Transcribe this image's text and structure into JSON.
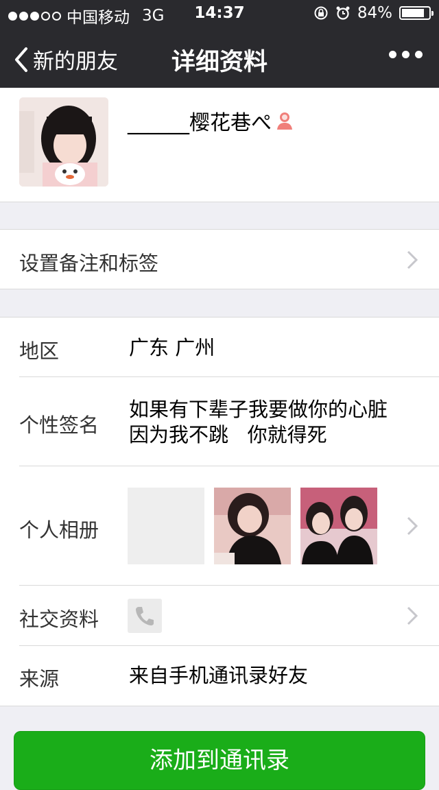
{
  "status_bar": {
    "carrier": "中国移动",
    "network": "3G",
    "time": "14:37",
    "battery": "84%",
    "battery_level": 0.84
  },
  "nav": {
    "back_label": "新的朋友",
    "title": "详细资料"
  },
  "profile": {
    "nickname": "______樱花巷ぺ"
  },
  "remark": {
    "label": "设置备注和标签"
  },
  "details": {
    "region_label": "地区",
    "region_value": "广东 广州",
    "signature_label": "个性签名",
    "signature_line1": "如果有下辈子我要做你的心脏",
    "signature_line2": "因为我不跳   你就得死",
    "album_label": "个人相册",
    "social_label": "社交资料",
    "source_label": "来源",
    "source_value": "来自手机通讯录好友"
  },
  "actions": {
    "add_label": "添加到通讯录"
  },
  "colors": {
    "bar_bg": "#2a2a2e",
    "accent_green": "#1aad19",
    "page_bg": "#efeff4"
  }
}
